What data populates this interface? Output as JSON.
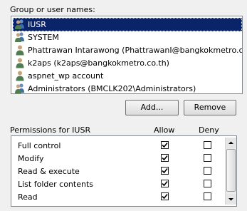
{
  "group_label": "Group or user names:",
  "users": [
    {
      "name": "IUSR",
      "icon": "group-users-icon",
      "selected": true
    },
    {
      "name": "SYSTEM",
      "icon": "group-users-icon",
      "selected": false
    },
    {
      "name": "Phattrawan Intarawong (PhattrawanI@bangkokmetro.co.th)",
      "icon": "user-icon",
      "selected": false
    },
    {
      "name": "k2aps (k2aps@bangkokmetro.co.th)",
      "icon": "user-icon",
      "selected": false
    },
    {
      "name": "aspnet_wp account",
      "icon": "user-icon",
      "selected": false
    },
    {
      "name": "Administrators (BMCLK202\\Administrators)",
      "icon": "group-users-icon",
      "selected": false
    }
  ],
  "buttons": {
    "add": "Add...",
    "remove": "Remove"
  },
  "permissions_header": {
    "title": "Permissions for IUSR",
    "allow": "Allow",
    "deny": "Deny"
  },
  "permissions": [
    {
      "name": "Full control",
      "allow": true,
      "deny": false
    },
    {
      "name": "Modify",
      "allow": true,
      "deny": false
    },
    {
      "name": "Read & execute",
      "allow": true,
      "deny": false
    },
    {
      "name": "List folder contents",
      "allow": true,
      "deny": false
    },
    {
      "name": "Read",
      "allow": true,
      "deny": false
    }
  ],
  "colors": {
    "selection": "#0a246a",
    "background": "#f0f0f0"
  }
}
